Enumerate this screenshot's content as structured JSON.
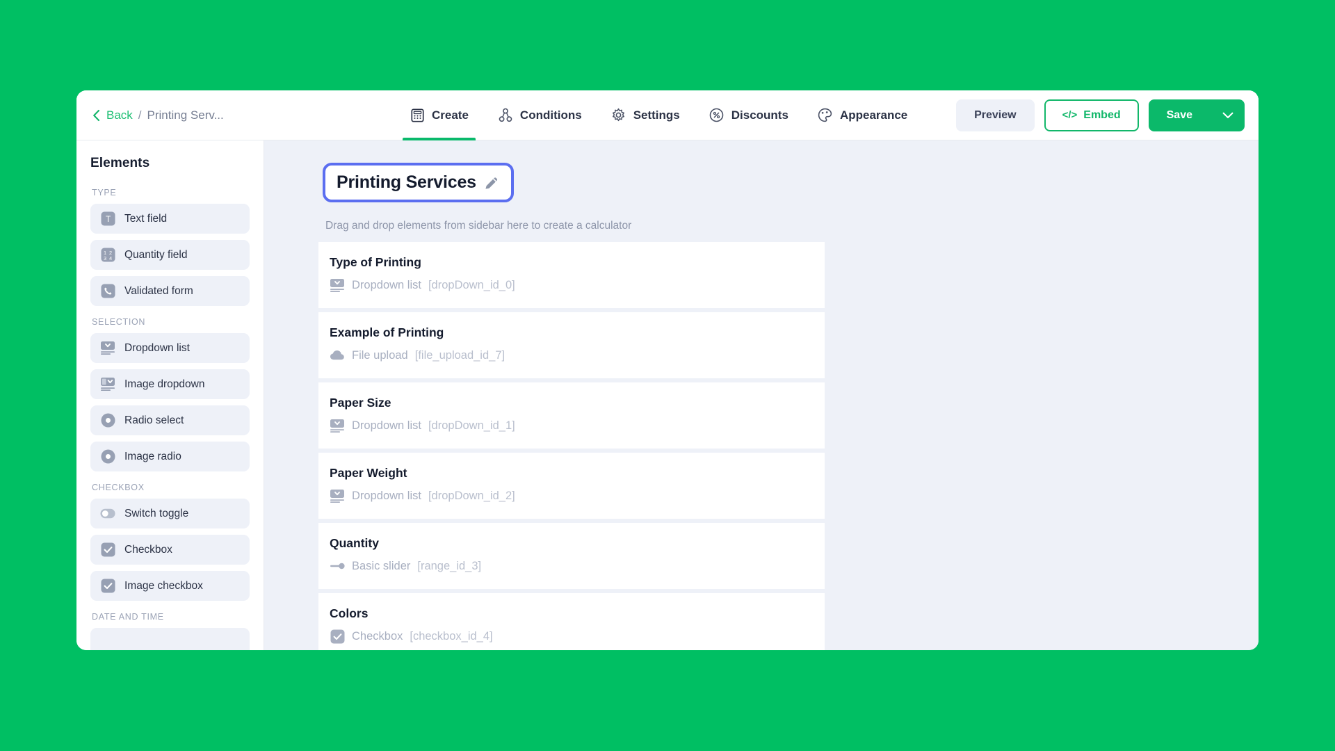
{
  "page": {
    "background_color": "#00bf63",
    "accent_green": "#0bb96a",
    "canvas_bg": "#eef1f8",
    "focus_ring": "#5b6ef0"
  },
  "topbar": {
    "breadcrumb": {
      "back_label": "Back",
      "separator": "/",
      "current": "Printing Serv...",
      "chevron_icon": "chevron-left-icon"
    },
    "tabs": [
      {
        "label": "Create",
        "icon": "calculator-icon",
        "active": true
      },
      {
        "label": "Conditions",
        "icon": "branch-icon",
        "active": false
      },
      {
        "label": "Settings",
        "icon": "gear-icon",
        "active": false
      },
      {
        "label": "Discounts",
        "icon": "percent-icon",
        "active": false
      },
      {
        "label": "Appearance",
        "icon": "palette-icon",
        "active": false
      }
    ],
    "actions": {
      "preview_label": "Preview",
      "embed_label": "Embed",
      "embed_icon": "code-icon",
      "save_label": "Save",
      "save_caret_icon": "chevron-down-icon"
    }
  },
  "sidebar": {
    "heading": "Elements",
    "groups": [
      {
        "label": "TYPE",
        "items": [
          {
            "label": "Text field",
            "icon": "text-field-icon"
          },
          {
            "label": "Quantity field",
            "icon": "number-grid-icon"
          },
          {
            "label": "Validated form",
            "icon": "phone-icon"
          }
        ]
      },
      {
        "label": "SELECTION",
        "items": [
          {
            "label": "Dropdown list",
            "icon": "dropdown-icon"
          },
          {
            "label": "Image dropdown",
            "icon": "image-dropdown-icon"
          },
          {
            "label": "Radio select",
            "icon": "radio-icon"
          },
          {
            "label": "Image radio",
            "icon": "image-radio-icon"
          }
        ]
      },
      {
        "label": "CHECKBOX",
        "items": [
          {
            "label": "Switch toggle",
            "icon": "toggle-icon"
          },
          {
            "label": "Checkbox",
            "icon": "checkbox-icon"
          },
          {
            "label": "Image checkbox",
            "icon": "image-checkbox-icon"
          }
        ]
      },
      {
        "label": "DATE AND TIME",
        "items": []
      }
    ]
  },
  "canvas": {
    "calculator_title": "Printing Services",
    "edit_icon": "pencil-icon",
    "hint": "Drag and drop elements from sidebar here to create a calculator",
    "cards": [
      {
        "title": "Type of Printing",
        "type_label": "Dropdown list",
        "element_id": "[dropDown_id_0]",
        "icon": "dropdown-icon"
      },
      {
        "title": "Example of Printing",
        "type_label": "File upload",
        "element_id": "[file_upload_id_7]",
        "icon": "upload-cloud-icon"
      },
      {
        "title": "Paper Size",
        "type_label": "Dropdown list",
        "element_id": "[dropDown_id_1]",
        "icon": "dropdown-icon"
      },
      {
        "title": "Paper Weight",
        "type_label": "Dropdown list",
        "element_id": "[dropDown_id_2]",
        "icon": "dropdown-icon"
      },
      {
        "title": "Quantity",
        "type_label": "Basic slider",
        "element_id": "[range_id_3]",
        "icon": "slider-icon"
      },
      {
        "title": "Colors",
        "type_label": "Checkbox",
        "element_id": "[checkbox_id_4]",
        "icon": "checkbox-icon"
      }
    ]
  }
}
